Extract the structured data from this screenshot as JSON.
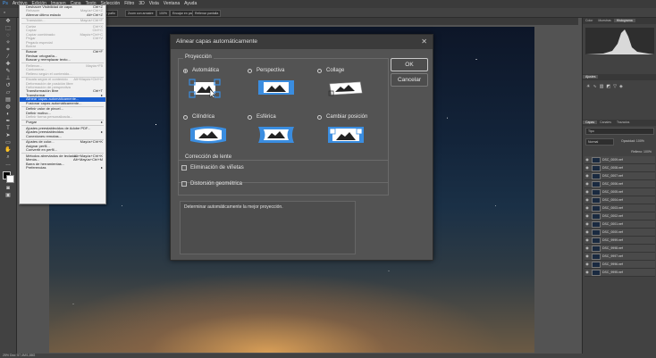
{
  "menubar": [
    "Archivo",
    "Edición",
    "Imagen",
    "Capa",
    "Texto",
    "Selección",
    "Filtro",
    "3D",
    "Vista",
    "Ventana",
    "Ayuda"
  ],
  "optionsbar": {
    "chip1": "Aumentar paño",
    "chip2": "Zoom con arrastre",
    "chip3": "100%",
    "chip4": "Encajar en pantalla",
    "chip5": "Rellenar pantalla"
  },
  "document_tab": "DSC_0009.NEF @ 25%",
  "statusbar": "25%  Doc: 57,4M/1,88G",
  "edit_menu": [
    {
      "label": "Deshacer Visibilidad de capa",
      "shortcut": "Ctrl+Z",
      "state": "enabled"
    },
    {
      "label": "Rehacer",
      "shortcut": "Mayús+Ctrl+Z",
      "state": "disabled"
    },
    {
      "label": "Alternar último estado",
      "shortcut": "Alt+Ctrl+Z",
      "state": "enabled"
    },
    {
      "sep": true
    },
    {
      "label": "Transición...",
      "shortcut": "Mayús+Ctrl+F",
      "state": "disabled"
    },
    {
      "sep": true
    },
    {
      "label": "Cortar",
      "shortcut": "Ctrl+X",
      "state": "disabled"
    },
    {
      "label": "Copiar",
      "shortcut": "Ctrl+C",
      "state": "disabled"
    },
    {
      "label": "Copiar combinado",
      "shortcut": "Mayús+Ctrl+C",
      "state": "disabled"
    },
    {
      "label": "Pegar",
      "shortcut": "Ctrl+V",
      "state": "disabled"
    },
    {
      "label": "Pegado especial",
      "shortcut": "",
      "state": "disabled"
    },
    {
      "label": "Borrar",
      "shortcut": "",
      "state": "disabled"
    },
    {
      "sep": true
    },
    {
      "label": "Buscar",
      "shortcut": "Ctrl+F",
      "state": "enabled"
    },
    {
      "label": "Revisar ortografía...",
      "shortcut": "",
      "state": "enabled"
    },
    {
      "label": "Buscar y reemplazar texto...",
      "shortcut": "",
      "state": "enabled"
    },
    {
      "sep": true
    },
    {
      "label": "Rellenar...",
      "shortcut": "Mayús+F5",
      "state": "disabled"
    },
    {
      "label": "Contornear...",
      "shortcut": "",
      "state": "disabled"
    },
    {
      "label": "Relleno según el contenido...",
      "shortcut": "",
      "state": "disabled"
    },
    {
      "sep": true
    },
    {
      "label": "Escala según el contenido",
      "shortcut": "Alt+Mayús+Ctrl+C",
      "state": "disabled"
    },
    {
      "label": "Deformación de posición libre",
      "shortcut": "",
      "state": "disabled"
    },
    {
      "label": "Deformación de perspectiva",
      "shortcut": "",
      "state": "disabled"
    },
    {
      "label": "Transformación libre",
      "shortcut": "Ctrl+T",
      "state": "enabled"
    },
    {
      "label": "Transformar",
      "shortcut": "▸",
      "state": "enabled"
    },
    {
      "label": "Alinear capas automáticamente...",
      "shortcut": "",
      "state": "highlighted"
    },
    {
      "label": "Fusionar capas automáticamente...",
      "shortcut": "",
      "state": "enabled"
    },
    {
      "sep": true
    },
    {
      "label": "Definir valor de pincel...",
      "shortcut": "",
      "state": "enabled"
    },
    {
      "label": "Definir motivo...",
      "shortcut": "",
      "state": "enabled"
    },
    {
      "label": "Definir forma personalizada...",
      "shortcut": "",
      "state": "disabled"
    },
    {
      "sep": true
    },
    {
      "label": "Purgar",
      "shortcut": "▸",
      "state": "enabled"
    },
    {
      "sep": true
    },
    {
      "label": "Ajustes preestablecidos de Adobe PDF...",
      "shortcut": "",
      "state": "enabled"
    },
    {
      "label": "Ajustes preestablecidos",
      "shortcut": "▸",
      "state": "enabled"
    },
    {
      "label": "Conexiones remotas...",
      "shortcut": "",
      "state": "enabled"
    },
    {
      "sep": true
    },
    {
      "label": "Ajustes de color...",
      "shortcut": "Mayús+Ctrl+K",
      "state": "enabled"
    },
    {
      "label": "Asignar perfil...",
      "shortcut": "",
      "state": "enabled"
    },
    {
      "label": "Convertir en perfil...",
      "shortcut": "",
      "state": "enabled"
    },
    {
      "sep": true
    },
    {
      "label": "Métodos abreviados de teclado...",
      "shortcut": "Alt+Mayús+Ctrl+K",
      "state": "enabled"
    },
    {
      "label": "Menús...",
      "shortcut": "Alt+Mayús+Ctrl+M",
      "state": "enabled"
    },
    {
      "label": "Barra de herramientas...",
      "shortcut": "",
      "state": "enabled"
    },
    {
      "label": "Preferencias",
      "shortcut": "▸",
      "state": "enabled"
    }
  ],
  "dialog": {
    "title": "Alinear capas automáticamente",
    "projection_label": "Proyección",
    "options": [
      "Automática",
      "Perspectiva",
      "Collage",
      "Cilíndrica",
      "Esférica",
      "Cambiar posición"
    ],
    "selected": "Automática",
    "lens_label": "Corrección de lente",
    "vignette": "Eliminación de viñetas",
    "distortion": "Distorsión geométrica",
    "info": "Determinar automáticamente la mejor proyección.",
    "ok": "OK",
    "cancel": "Cancelar"
  },
  "panels": {
    "top_tabs": [
      "Color",
      "Muestras",
      "Histograma"
    ],
    "adjust_tab": "Ajustes",
    "layers_tabs": [
      "Capas",
      "Canales",
      "Trazados"
    ],
    "kind": "Tipo",
    "blend": "Normal",
    "opacity": "Opacidad: 100%",
    "fill": "Relleno: 100%",
    "layers": [
      "DSC_0009.nef",
      "DSC_0008.nef",
      "DSC_0007.nef",
      "DSC_0006.nef",
      "DSC_0005.nef",
      "DSC_0004.nef",
      "DSC_0003.nef",
      "DSC_0002.nef",
      "DSC_0001.nef",
      "DSC_0000.nef",
      "DSC_9999.nef",
      "DSC_9998.nef",
      "DSC_9997.nef",
      "DSC_9996.nef",
      "DSC_9995.nef"
    ]
  },
  "colors": {
    "accent": "#1a5fd0",
    "icon_blue": "#3a8de0",
    "dialog_bg": "#535353",
    "title_bg": "#3b3b3b"
  }
}
